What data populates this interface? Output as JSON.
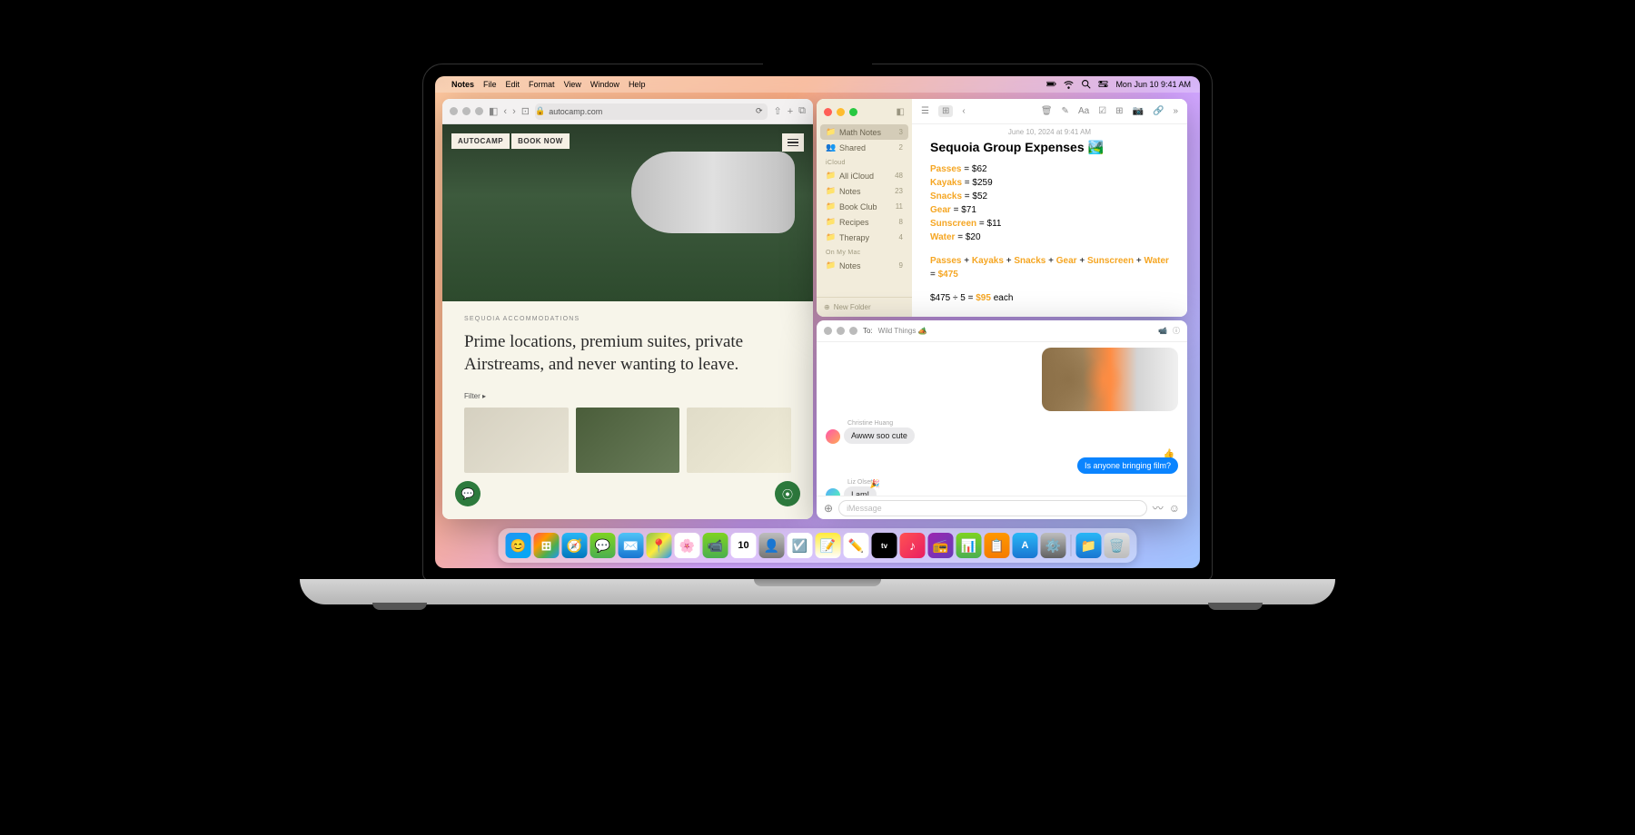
{
  "menubar": {
    "app": "Notes",
    "items": [
      "File",
      "Edit",
      "Format",
      "View",
      "Window",
      "Help"
    ],
    "clock": "Mon Jun 10  9:41 AM"
  },
  "safari": {
    "url": "autocamp.com",
    "nav_logo": "AUTOCAMP",
    "nav_book": "BOOK NOW",
    "eyebrow": "SEQUOIA ACCOMMODATIONS",
    "headline": "Prime locations, premium suites, private Airstreams, and never wanting to leave.",
    "filter": "Filter ▸"
  },
  "notes": {
    "sidebar": {
      "top_items": [
        {
          "icon": "📁",
          "name": "Math Notes",
          "count": "3",
          "selected": true
        },
        {
          "icon": "👥",
          "name": "Shared",
          "count": "2"
        }
      ],
      "section1_header": "iCloud",
      "section1_items": [
        {
          "icon": "📁",
          "name": "All iCloud",
          "count": "48"
        },
        {
          "icon": "📁",
          "name": "Notes",
          "count": "23"
        },
        {
          "icon": "📁",
          "name": "Book Club",
          "count": "11"
        },
        {
          "icon": "📁",
          "name": "Recipes",
          "count": "8"
        },
        {
          "icon": "📁",
          "name": "Therapy",
          "count": "4"
        }
      ],
      "section2_header": "On My Mac",
      "section2_items": [
        {
          "icon": "📁",
          "name": "Notes",
          "count": "9"
        }
      ],
      "new_folder": "New Folder"
    },
    "note": {
      "date": "June 10, 2024 at 9:41 AM",
      "title": "Sequoia Group Expenses 🏞️",
      "lines": [
        {
          "key": "Passes",
          "val": "$62"
        },
        {
          "key": "Kayaks",
          "val": "$259"
        },
        {
          "key": "Snacks",
          "val": "$52"
        },
        {
          "key": "Gear",
          "val": "$71"
        },
        {
          "key": "Sunscreen",
          "val": "$11"
        },
        {
          "key": "Water",
          "val": "$20"
        }
      ],
      "sum_parts": [
        "Passes",
        "Kayaks",
        "Snacks",
        "Gear",
        "Sunscreen",
        "Water"
      ],
      "sum_total": "$475",
      "division": "$475 ÷ 5 = ",
      "division_result": "$95",
      "division_suffix": " each"
    }
  },
  "messages": {
    "to_label": "To:",
    "to_value": "Wild Things 🏕️",
    "thread": [
      {
        "type": "image_out"
      },
      {
        "type": "in",
        "from": "Christine Huang",
        "text": "Awww soo cute",
        "avatar": "a"
      },
      {
        "type": "out",
        "tapback": "👍",
        "text": "Is anyone bringing film?"
      },
      {
        "type": "in",
        "from": "Liz Olsen",
        "text": "I am!",
        "avatar": "b",
        "tapback": "🎉"
      }
    ],
    "input_placeholder": "iMessage"
  },
  "dock": [
    {
      "name": "finder",
      "bg": "linear-gradient(135deg,#2196f3,#03a9f4)",
      "glyph": "😊"
    },
    {
      "name": "launchpad",
      "bg": "linear-gradient(135deg,#ff5252,#ff9800,#4caf50,#2196f3)",
      "glyph": "⊞"
    },
    {
      "name": "safari",
      "bg": "linear-gradient(180deg,#29b6f6,#0277bd)",
      "glyph": "🧭"
    },
    {
      "name": "messages",
      "bg": "linear-gradient(180deg,#7ed321,#4caf50)",
      "glyph": "💬"
    },
    {
      "name": "mail",
      "bg": "linear-gradient(180deg,#4fc3f7,#1976d2)",
      "glyph": "✉️"
    },
    {
      "name": "maps",
      "bg": "linear-gradient(135deg,#8bc34a,#ffeb3b,#2196f3)",
      "glyph": "📍"
    },
    {
      "name": "photos",
      "bg": "#fff",
      "glyph": "🌸"
    },
    {
      "name": "facetime",
      "bg": "linear-gradient(180deg,#7ed321,#4caf50)",
      "glyph": "📹"
    },
    {
      "name": "calendar",
      "bg": "#fff",
      "glyph": "10",
      "text": true,
      "color": "#000"
    },
    {
      "name": "contacts",
      "bg": "linear-gradient(180deg,#bdbdbd,#757575)",
      "glyph": "👤"
    },
    {
      "name": "reminders",
      "bg": "#fff",
      "glyph": "☑️"
    },
    {
      "name": "notes",
      "bg": "linear-gradient(180deg,#ffeb3b,#fff)",
      "glyph": "📝"
    },
    {
      "name": "freeform",
      "bg": "#fff",
      "glyph": "✏️"
    },
    {
      "name": "tv",
      "bg": "#000",
      "glyph": "tv",
      "text": true,
      "color": "#fff",
      "fs": "8px"
    },
    {
      "name": "music",
      "bg": "linear-gradient(135deg,#ff5252,#e91e63)",
      "glyph": "♪"
    },
    {
      "name": "podcasts",
      "bg": "linear-gradient(135deg,#9c27b0,#673ab7)",
      "glyph": "📻"
    },
    {
      "name": "numbers",
      "bg": "linear-gradient(180deg,#7ed321,#4caf50)",
      "glyph": "📊"
    },
    {
      "name": "keynote",
      "bg": "linear-gradient(180deg,#ff9800,#f57c00)",
      "glyph": "📋"
    },
    {
      "name": "appstore",
      "bg": "linear-gradient(180deg,#29b6f6,#1976d2)",
      "glyph": "A",
      "text": true
    },
    {
      "name": "settings",
      "bg": "linear-gradient(180deg,#bdbdbd,#616161)",
      "glyph": "⚙️"
    },
    {
      "sep": true
    },
    {
      "name": "downloads",
      "bg": "linear-gradient(180deg,#29b6f6,#1976d2)",
      "glyph": "📁"
    },
    {
      "name": "trash",
      "bg": "linear-gradient(180deg,#e0e0e0,#bdbdbd)",
      "glyph": "🗑️"
    }
  ]
}
